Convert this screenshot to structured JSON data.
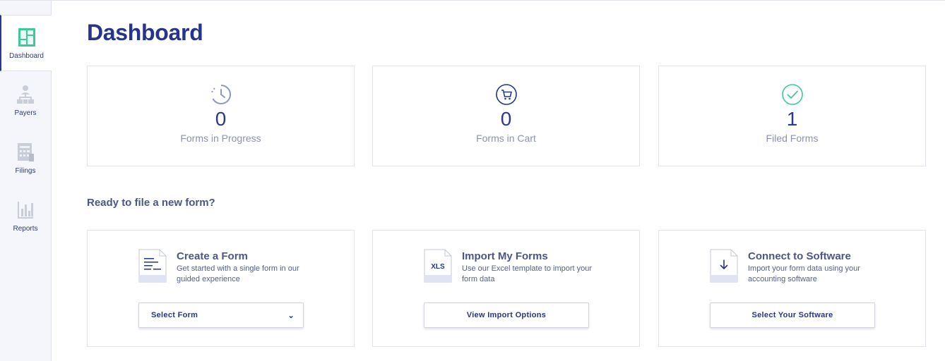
{
  "sidebar": {
    "items": [
      {
        "label": "Dashboard",
        "icon": "dashboard-icon",
        "active": true
      },
      {
        "label": "Payers",
        "icon": "payers-icon",
        "active": false
      },
      {
        "label": "Filings",
        "icon": "filings-icon",
        "active": false
      },
      {
        "label": "Reports",
        "icon": "reports-icon",
        "active": false
      }
    ]
  },
  "main": {
    "title": "Dashboard",
    "stats": [
      {
        "value": "0",
        "label": "Forms in Progress",
        "icon": "clock-icon"
      },
      {
        "value": "0",
        "label": "Forms in Cart",
        "icon": "cart-icon"
      },
      {
        "value": "1",
        "label": "Filed Forms",
        "icon": "check-circle-icon"
      }
    ],
    "new_form_heading": "Ready to file a new form?",
    "actions": [
      {
        "title": "Create a Form",
        "description": "Get started with a single form in our guided experience",
        "button": "Select Form",
        "icon": "document-lines-icon"
      },
      {
        "title": "Import My Forms",
        "description": "Use our Excel template to import your form data",
        "button": "View Import Options",
        "icon": "xls-file-icon",
        "icon_text": "XLS"
      },
      {
        "title": "Connect to Software",
        "description": "Import your form data using your accounting software",
        "button": "Select Your Software",
        "icon": "download-file-icon"
      }
    ]
  },
  "colors": {
    "brand": "#27348b",
    "accent_green": "#3ec99a",
    "muted_text": "#8c93aa",
    "sidebar_bg": "#f4f6fb"
  }
}
